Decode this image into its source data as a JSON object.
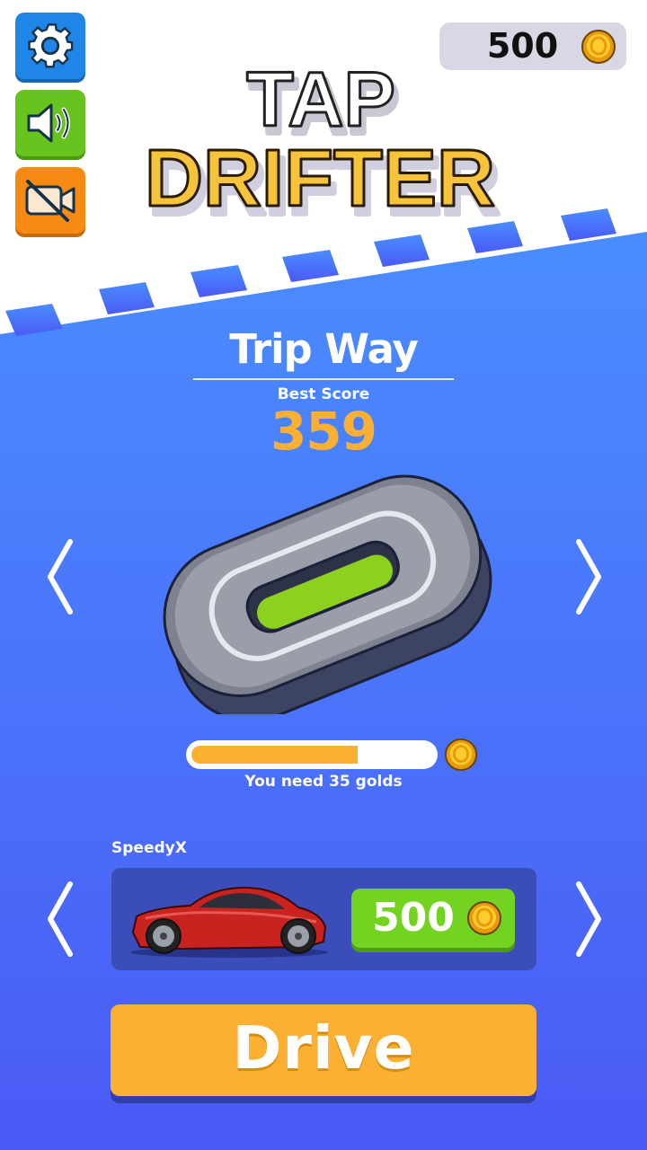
{
  "header": {
    "coins": "500",
    "logo_line1": "TAP",
    "logo_line2": "DRIFTER"
  },
  "side_buttons": {
    "settings_icon": "gear-icon",
    "sound_icon": "speaker-icon",
    "video_icon": "video-off-icon"
  },
  "track": {
    "name": "Trip Way",
    "best_score_label": "Best Score",
    "best_score": "359",
    "unlock_progress": 0.69,
    "need_text": "You need 35 golds"
  },
  "car": {
    "name": "SpeedyX",
    "price": "500"
  },
  "drive_label": "Drive",
  "colors": {
    "sky_top": "#4c8cff",
    "sky_bottom": "#4a5cf5",
    "gold": "#fbb034",
    "buy_green": "#72d421"
  }
}
